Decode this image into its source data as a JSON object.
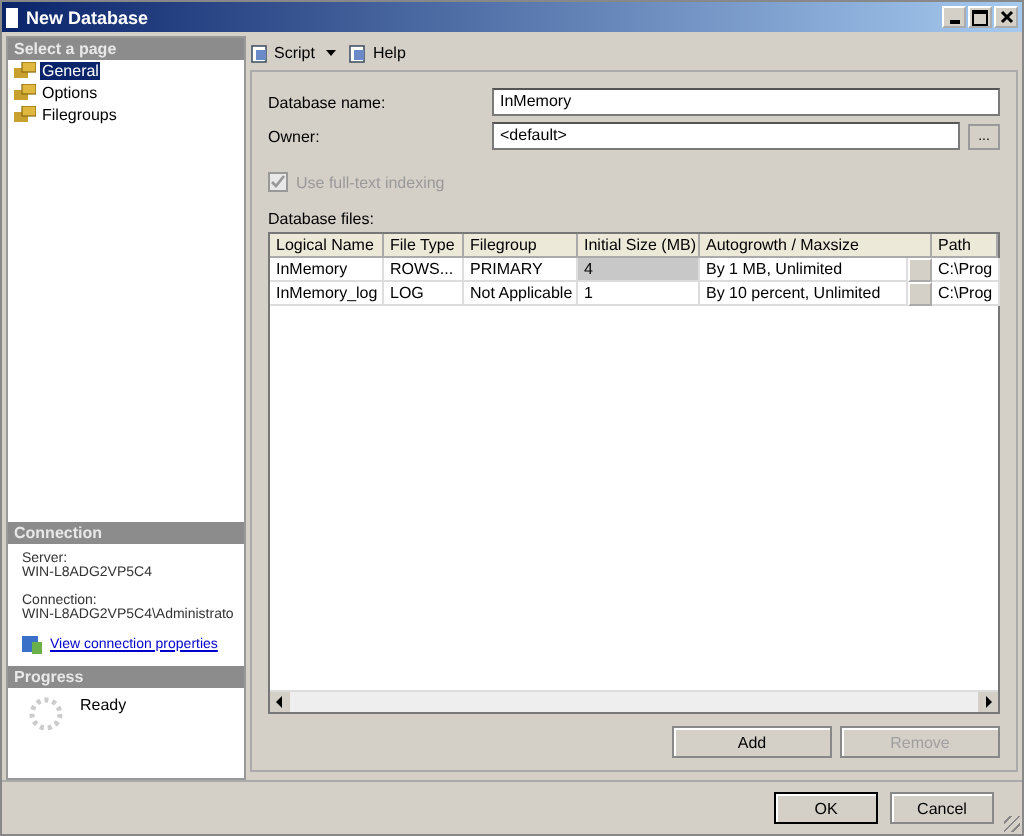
{
  "window": {
    "title": "New Database"
  },
  "sidebar": {
    "header": "Select a page",
    "items": [
      {
        "label": "General",
        "selected": true
      },
      {
        "label": "Options",
        "selected": false
      },
      {
        "label": "Filegroups",
        "selected": false
      }
    ]
  },
  "connection": {
    "header": "Connection",
    "server_label": "Server:",
    "server": "WIN-L8ADG2VP5C4",
    "connection_label": "Connection:",
    "connection": "WIN-L8ADG2VP5C4\\Administrato",
    "link": "View connection properties"
  },
  "progress": {
    "header": "Progress",
    "status": "Ready"
  },
  "toolbar": {
    "items": [
      "Script",
      "Help"
    ]
  },
  "form": {
    "name_label": "Database name:",
    "name_value": "InMemory",
    "owner_label": "Owner:",
    "owner_value": "<default>",
    "browse": "...",
    "fulltext": {
      "label": "Use full-text indexing",
      "checked": true,
      "disabled": true
    }
  },
  "files": {
    "label": "Database files:",
    "columns": [
      "Logical Name",
      "File Type",
      "Filegroup",
      "Initial Size (MB)",
      "Autogrowth / Maxsize",
      "Path"
    ],
    "rows": [
      {
        "cells": [
          "InMemory",
          "ROWS...",
          "PRIMARY",
          "4",
          "By 1 MB, Unlimited",
          "C:\\Prog"
        ],
        "selected": true
      },
      {
        "cells": [
          "InMemory_log",
          "LOG",
          "Not Applicable",
          "1",
          "By 10 percent, Unlimited",
          "C:\\Prog"
        ],
        "selected": false
      }
    ]
  },
  "buttons": [
    {
      "label": "Add",
      "disabled": false
    },
    {
      "label": "Remove",
      "disabled": true
    }
  ],
  "dialog_buttons": [
    "OK",
    "Cancel"
  ]
}
